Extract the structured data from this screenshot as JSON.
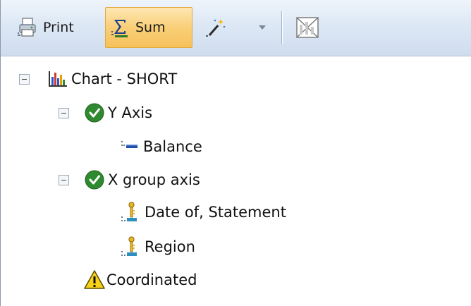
{
  "toolbar": {
    "print_label": "Print",
    "sum_label": "Sum",
    "icons": {
      "print": "print-icon",
      "sum": "sigma-sum-icon",
      "magic": "magic-wand-icon",
      "dropdown": "dropdown-arrow-icon",
      "nochart": "no-chart-icon"
    },
    "colors": {
      "sum_highlight": "#f9cf78",
      "toolbar_bg": "#dde8f5"
    }
  },
  "tree": {
    "root": {
      "label": "Chart - SHORT",
      "icon": "bar-chart-icon",
      "expanded": true
    },
    "y_axis": {
      "label": "Y Axis",
      "icon": "check-circle-icon",
      "expanded": true,
      "children": [
        {
          "label": "Balance",
          "icon": "measure-field-icon"
        }
      ]
    },
    "x_axis": {
      "label": "X group axis",
      "icon": "check-circle-icon",
      "expanded": true,
      "children": [
        {
          "label": "Date of, Statement",
          "icon": "key-dimension-icon"
        },
        {
          "label": "Region",
          "icon": "key-dimension-icon"
        }
      ]
    },
    "coordinated": {
      "label": "Coordinated",
      "icon": "warning-icon"
    }
  }
}
